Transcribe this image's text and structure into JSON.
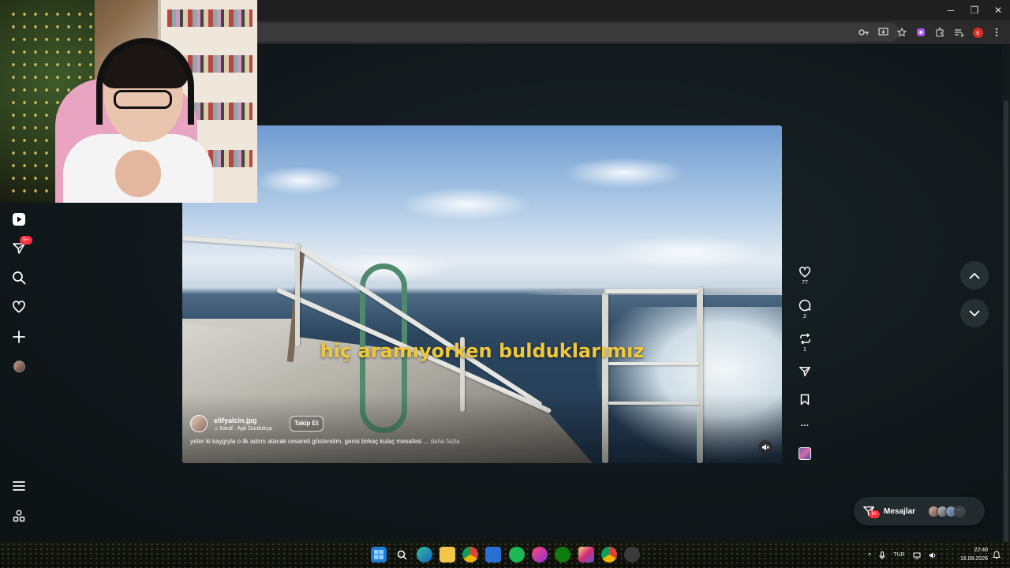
{
  "window": {
    "minimize_glyph": "─",
    "maximize_glyph": "❐",
    "close_glyph": "✕"
  },
  "browser": {
    "profile_initial": "s",
    "toolbar_icons": [
      "password-key-icon",
      "install-app-icon",
      "bookmark-star-icon",
      "extension-icon",
      "puzzle-icon",
      "media-queue-icon",
      "profile-avatar-icon",
      "more-menu-icon"
    ]
  },
  "sidebar": {
    "notifications_badge": "9+",
    "items": [
      "reels-icon",
      "direct-icon",
      "search-icon",
      "heart-icon",
      "create-icon",
      "profile-avatar"
    ],
    "bottom_items": [
      "menu-icon",
      "also-from-meta-icon"
    ]
  },
  "reel": {
    "caption_overlay": "hiç aramıyorken bulduklarımız",
    "username": "elifyalcin.jpg",
    "audio": "♫ Karaf · Aşk Durdukça",
    "follow_label": "Takip Et",
    "description": "yeter ki kaygıyla o ilk adımı atacak cesareti gösterelim. gerisi birkaç kulaç mesafesi ...",
    "more_label": "daha fazla",
    "mute_glyph": "🔇"
  },
  "actions": {
    "likes": "77",
    "comments": "2",
    "reposts": "1",
    "more_glyph": "···"
  },
  "messages": {
    "label": "Mesajlar",
    "badge": "9+",
    "more_glyph": "···"
  },
  "taskbar": {
    "language": "TUR",
    "time": "22:40",
    "date": "16.08.2026",
    "chevron": "^"
  },
  "colors": {
    "caption": "#f0c83a",
    "badge": "#ff3040",
    "page_bg": "#121a1d"
  }
}
